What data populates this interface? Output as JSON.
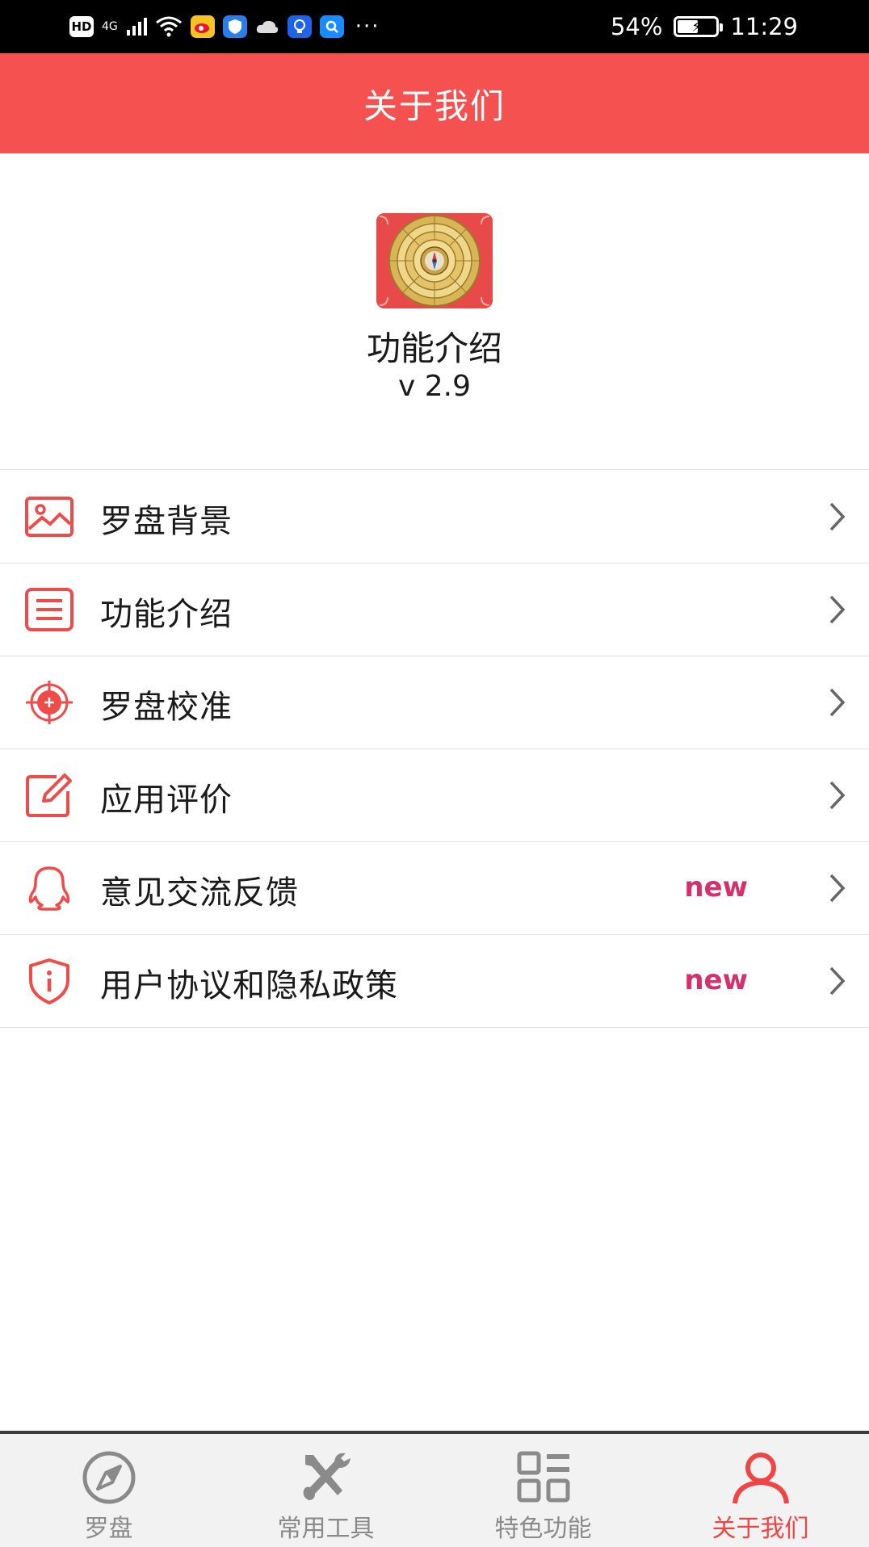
{
  "status_bar": {
    "hd_label": "HD",
    "network_label": "4G",
    "battery_text": "54%",
    "battery_level": 0.54,
    "time": "11:29"
  },
  "header": {
    "title": "关于我们"
  },
  "app_info": {
    "name": "功能介绍",
    "version": "v 2.9"
  },
  "menu": {
    "items": [
      {
        "label": "罗盘背景",
        "icon": "image-icon",
        "badge": ""
      },
      {
        "label": "功能介绍",
        "icon": "list-icon",
        "badge": ""
      },
      {
        "label": "罗盘校准",
        "icon": "target-icon",
        "badge": ""
      },
      {
        "label": "应用评价",
        "icon": "edit-icon",
        "badge": ""
      },
      {
        "label": "意见交流反馈",
        "icon": "qq-icon",
        "badge": "new"
      },
      {
        "label": "用户协议和隐私政策",
        "icon": "shield-info-icon",
        "badge": "new"
      }
    ]
  },
  "bottom_nav": {
    "items": [
      {
        "label": "罗盘",
        "icon": "compass-icon",
        "active": false
      },
      {
        "label": "常用工具",
        "icon": "tools-icon",
        "active": false
      },
      {
        "label": "特色功能",
        "icon": "grid-icon",
        "active": false
      },
      {
        "label": "关于我们",
        "icon": "user-icon",
        "active": true
      }
    ]
  },
  "colors": {
    "accent": "#f65151",
    "badge": "#d4306d",
    "nav_inactive": "#8a8a8a",
    "nav_active": "#f04545"
  }
}
